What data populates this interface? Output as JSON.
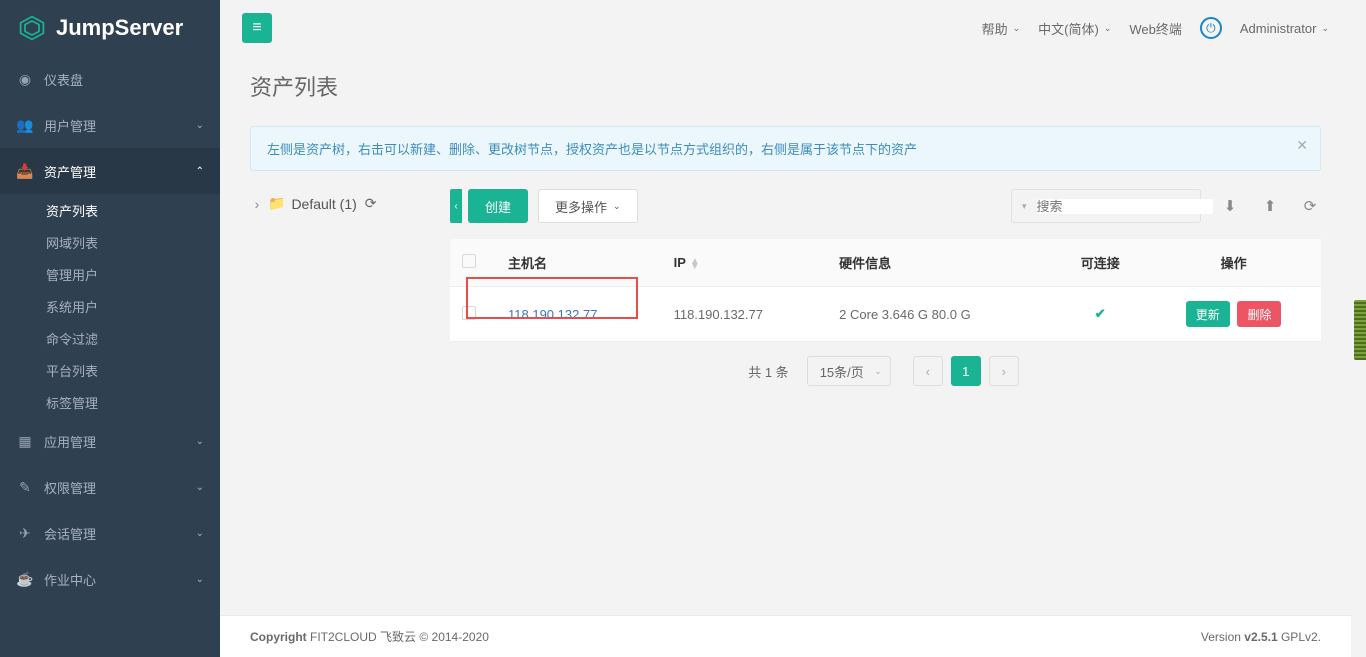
{
  "brand": "JumpServer",
  "topbar": {
    "help": "帮助",
    "lang": "中文(简体)",
    "webterm": "Web终端",
    "user": "Administrator"
  },
  "sidebar": {
    "dashboard": "仪表盘",
    "user_mgmt": "用户管理",
    "asset_mgmt": "资产管理",
    "asset_sub": {
      "asset_list": "资产列表",
      "domain_list": "网域列表",
      "admin_user": "管理用户",
      "system_user": "系统用户",
      "cmd_filter": "命令过滤",
      "platform_list": "平台列表",
      "label_mgmt": "标签管理"
    },
    "app_mgmt": "应用管理",
    "perm_mgmt": "权限管理",
    "session_mgmt": "会话管理",
    "job_center": "作业中心"
  },
  "page_title": "资产列表",
  "alert_text": "左侧是资产树，右击可以新建、删除、更改树节点，授权资产也是以节点方式组织的，右侧是属于该节点下的资产",
  "tree": {
    "root": "Default (1)"
  },
  "toolbar": {
    "create": "创建",
    "more": "更多操作",
    "search_placeholder": "搜索"
  },
  "table": {
    "headers": {
      "hostname": "主机名",
      "ip": "IP",
      "hardware": "硬件信息",
      "reachable": "可连接",
      "action": "操作"
    },
    "rows": [
      {
        "hostname": "118.190.132.77",
        "ip": "118.190.132.77",
        "hardware": "2 Core 3.646 G 80.0 G",
        "reachable": true
      }
    ],
    "action_update": "更新",
    "action_delete": "删除"
  },
  "pagination": {
    "total_text": "共 1 条",
    "per_page": "15条/页",
    "current": "1"
  },
  "footer": {
    "left_strong": "Copyright",
    "left_rest": " FIT2CLOUD 飞致云 © 2014-2020",
    "right_prefix": "Version ",
    "version": "v2.5.1",
    "license": " GPLv2."
  }
}
